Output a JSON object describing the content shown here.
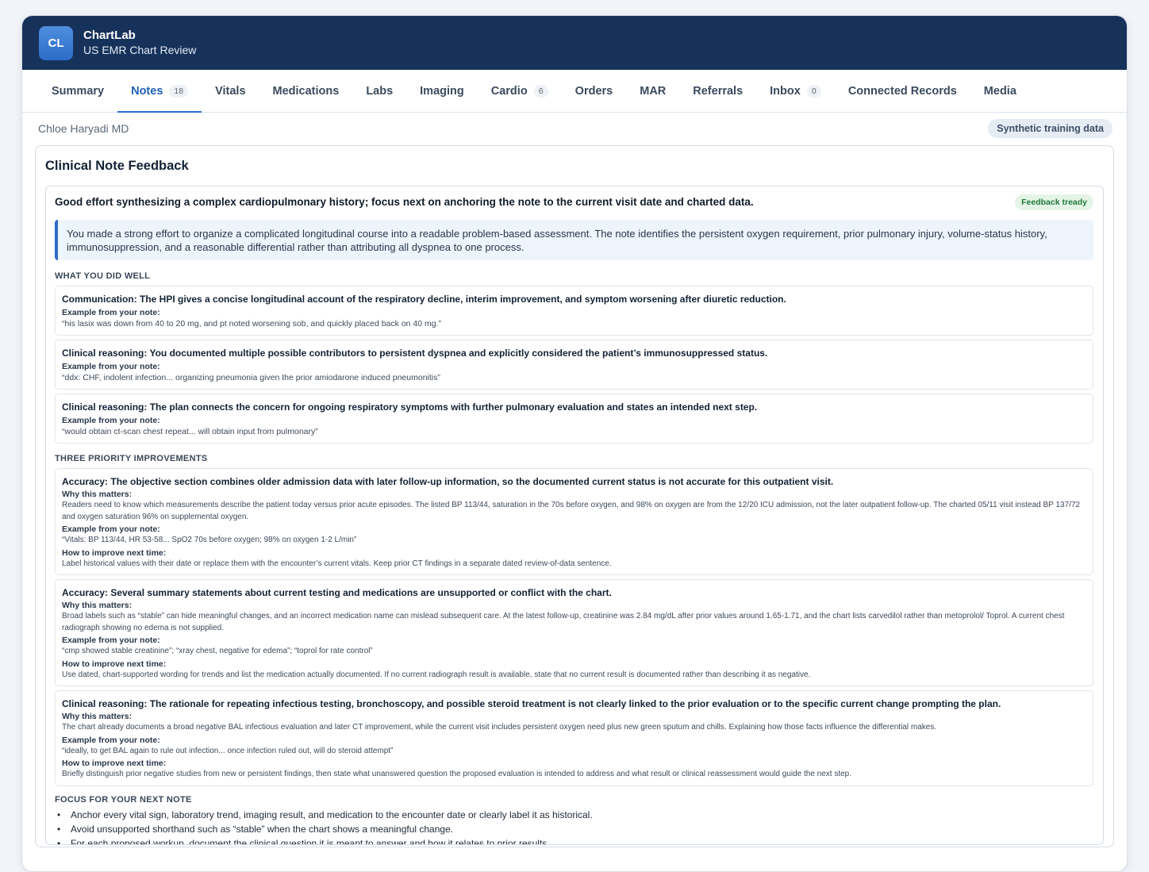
{
  "app": {
    "logo_text": "CL",
    "name": "ChartLab",
    "subtitle": "US EMR Chart Review"
  },
  "tabs": [
    {
      "label": "Summary",
      "badge": null
    },
    {
      "label": "Notes",
      "badge": "18",
      "active": true
    },
    {
      "label": "Vitals",
      "badge": null
    },
    {
      "label": "Medications",
      "badge": null
    },
    {
      "label": "Labs",
      "badge": null
    },
    {
      "label": "Imaging",
      "badge": null
    },
    {
      "label": "Cardio",
      "badge": "6"
    },
    {
      "label": "Orders",
      "badge": null
    },
    {
      "label": "MAR",
      "badge": null
    },
    {
      "label": "Referrals",
      "badge": null
    },
    {
      "label": "Inbox",
      "badge": "0"
    },
    {
      "label": "Connected Records",
      "badge": null
    },
    {
      "label": "Media",
      "badge": null
    }
  ],
  "subheader": {
    "author": "Chloe Haryadi MD",
    "tag": "Synthetic training data"
  },
  "feedback": {
    "title": "Clinical Note Feedback",
    "headline": "Good effort synthesizing a complex cardiopulmonary history; focus next on anchoring the note to the current visit date and charted data.",
    "status": "Feedback tready",
    "summary": "You made a strong effort to organize a complicated longitudinal course into a readable problem-based assessment. The note identifies the persistent oxygen requirement, prior pulmonary injury, volume-status history, immunosuppression, and a reasonable differential rather than attributing all dyspnea to one process.",
    "well_label": "WHAT YOU DID WELL",
    "example_label": "Example from your note:",
    "why_label": "Why this matters:",
    "how_label": "How to improve next time:",
    "strengths": [
      {
        "title": "Communication: The HPI gives a concise longitudinal account of the respiratory decline, interim improvement, and symptom worsening after diuretic reduction.",
        "example": "“his lasix was down from 40 to 20 mg, and pt noted worsening sob, and quickly placed back on 40 mg.”"
      },
      {
        "title": "Clinical reasoning: You documented multiple possible contributors to persistent dyspnea and explicitly considered the patient’s immunosuppressed status.",
        "example": "“ddx: CHF, indolent infection... organizing pneumonia given the prior amiodarone induced pneumonitis”"
      },
      {
        "title": "Clinical reasoning: The plan connects the concern for ongoing respiratory symptoms with further pulmonary evaluation and states an intended next step.",
        "example": "“would obtain ct-scan chest repeat... will obtain input from pulmonary”"
      }
    ],
    "improve_label": "THREE PRIORITY IMPROVEMENTS",
    "improvements": [
      {
        "title": "Accuracy: The objective section combines older admission data with later follow-up information, so the documented current status is not accurate for this outpatient visit.",
        "why": "Readers need to know which measurements describe the patient today versus prior acute episodes. The listed BP 113/44, saturation in the 70s before oxygen, and 98% on oxygen are from the 12/20 ICU admission, not the later outpatient follow-up. The charted 05/11 visit instead BP 137/72 and oxygen saturation 96% on supplemental oxygen.",
        "example": "“Vitals: BP 113/44, HR 53-58... SpO2 70s before oxygen; 98% on oxygen 1-2 L/min”",
        "how": "Label historical values with their date or replace them with the encounter’s current vitals. Keep prior CT findings in a separate dated review-of-data sentence."
      },
      {
        "title": "Accuracy: Several summary statements about current testing and medications are unsupported or conflict with the chart.",
        "why": "Broad labels such as “stable” can hide meaningful changes, and an incorrect medication name can mislead subsequent care. At the latest follow-up, creatinine was 2.84 mg/dL after prior values around 1.65-1.71, and the chart lists carvedilol rather than metoprolol/ Toprol. A current chest radiograph showing no edema is not supplied.",
        "example": "“cmp showed stable creatinine”; “xray chest, negative for edema”; “toprol for rate control”",
        "how": "Use dated, chart-supported wording for trends and list the medication actually documented. If no current radiograph result is available, state that no current result is documented rather than describing it as negative."
      },
      {
        "title": "Clinical reasoning: The rationale for repeating infectious testing, bronchoscopy, and possible steroid treatment is not clearly linked to the prior evaluation or to the specific current change prompting the plan.",
        "why": "The chart already documents a broad negative BAL infectious evaluation and later CT improvement, while the current visit includes persistent oxygen need plus new green sputum and chills. Explaining how those facts influence the differential makes.",
        "example": "“ideally, to get BAL again to rule out infection... once infection ruled out, will do steroid attempt”",
        "how": "Briefly distinguish prior negative studies from new or persistent findings, then state what unanswered question the proposed evaluation is intended to address and what result or clinical reassessment would guide the next step."
      }
    ],
    "focus_label": "FOCUS FOR YOUR NEXT NOTE",
    "focus": [
      "Anchor every vital sign, laboratory trend, imaging result, and medication to the encounter date or clearly label it as historical.",
      "Avoid unsupported shorthand such as “stable” when the chart shows a meaningful change.",
      "For each proposed workup, document the clinical question it is meant to answer and how it relates to prior results."
    ]
  }
}
